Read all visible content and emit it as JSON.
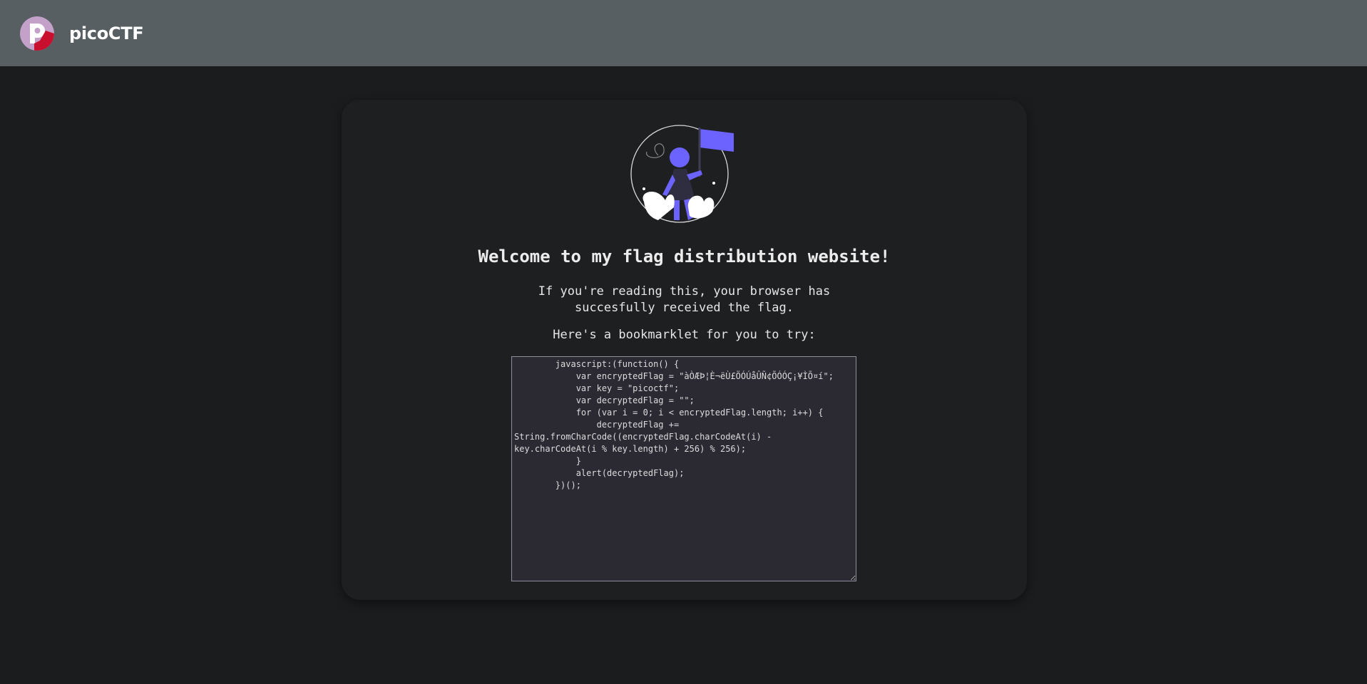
{
  "header": {
    "brand_name": "picoCTF",
    "logo_icon": "picoctf-logo-icon",
    "background_color": "#575f63"
  },
  "main": {
    "hero_icon": "person-holding-flag-illustration",
    "accent_color": "#6c63ff",
    "title": "Welcome to my flag distribution website!",
    "description": "If you're reading this, your browser has succesfully received the flag.",
    "prompt": "Here's a bookmarklet for you to try:",
    "bookmarklet_code": "        javascript:(function() {\n            var encryptedFlag = \"àÒÆÞ¦È¬ëÙ£ÖÓÚåÛÑ¢ÕÓÓÇ¡¥ÌÕ¤í\";\n            var key = \"picoctf\";\n            var decryptedFlag = \"\";\n            for (var i = 0; i < encryptedFlag.length; i++) {\n                decryptedFlag += String.fromCharCode((encryptedFlag.charCodeAt(i) - key.charCodeAt(i % key.length) + 256) % 256);\n            }\n            alert(decryptedFlag);\n        })();"
  }
}
